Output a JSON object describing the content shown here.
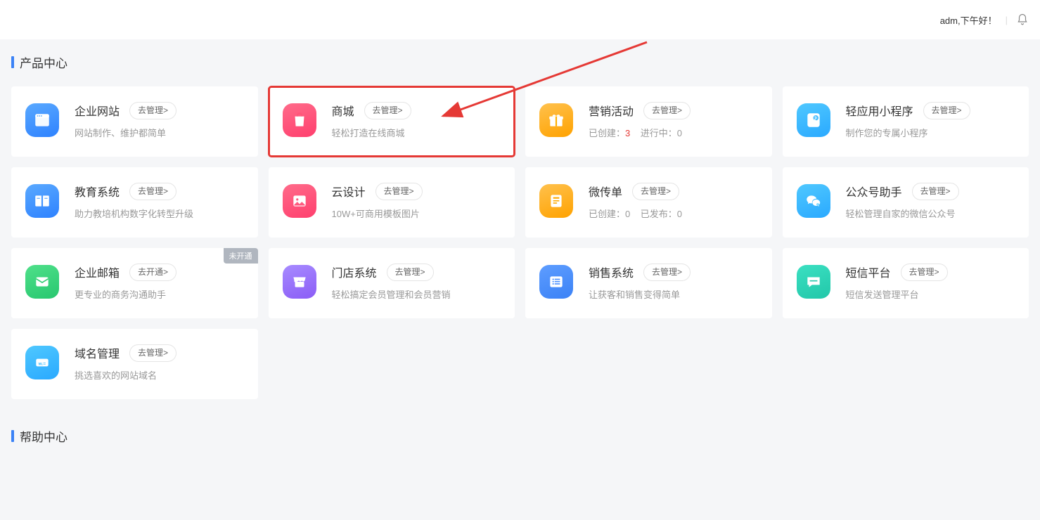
{
  "header": {
    "greeting": "adm,下午好！"
  },
  "sections": {
    "product_center": "产品中心",
    "help_center": "帮助中心"
  },
  "common": {
    "manage_btn": "去管理>",
    "open_btn": "去开通>",
    "not_open_badge": "未开通"
  },
  "cards": {
    "site": {
      "title": "企业网站",
      "desc": "网站制作、维护都简单"
    },
    "mall": {
      "title": "商城",
      "desc": "轻松打造在线商城"
    },
    "marketing": {
      "title": "营销活动",
      "created_label": "已创建：",
      "created_count": "3",
      "running_label": "进行中：",
      "running_count": "0"
    },
    "miniapp": {
      "title": "轻应用小程序",
      "desc": "制作您的专属小程序"
    },
    "edu": {
      "title": "教育系统",
      "desc": "助力教培机构数字化转型升级"
    },
    "design": {
      "title": "云设计",
      "desc": "10W+可商用模板图片"
    },
    "flyer": {
      "title": "微传单",
      "created_label": "已创建：",
      "created_count": "0",
      "pub_label": "已发布：",
      "pub_count": "0"
    },
    "mp": {
      "title": "公众号助手",
      "desc": "轻松管理自家的微信公众号"
    },
    "mail": {
      "title": "企业邮箱",
      "desc": "更专业的商务沟通助手"
    },
    "store": {
      "title": "门店系统",
      "desc": "轻松搞定会员管理和会员营销"
    },
    "sales": {
      "title": "销售系统",
      "desc": "让获客和销售变得简单"
    },
    "sms": {
      "title": "短信平台",
      "desc": "短信发送管理平台"
    },
    "domain": {
      "title": "域名管理",
      "desc": "挑选喜欢的网站域名"
    }
  }
}
